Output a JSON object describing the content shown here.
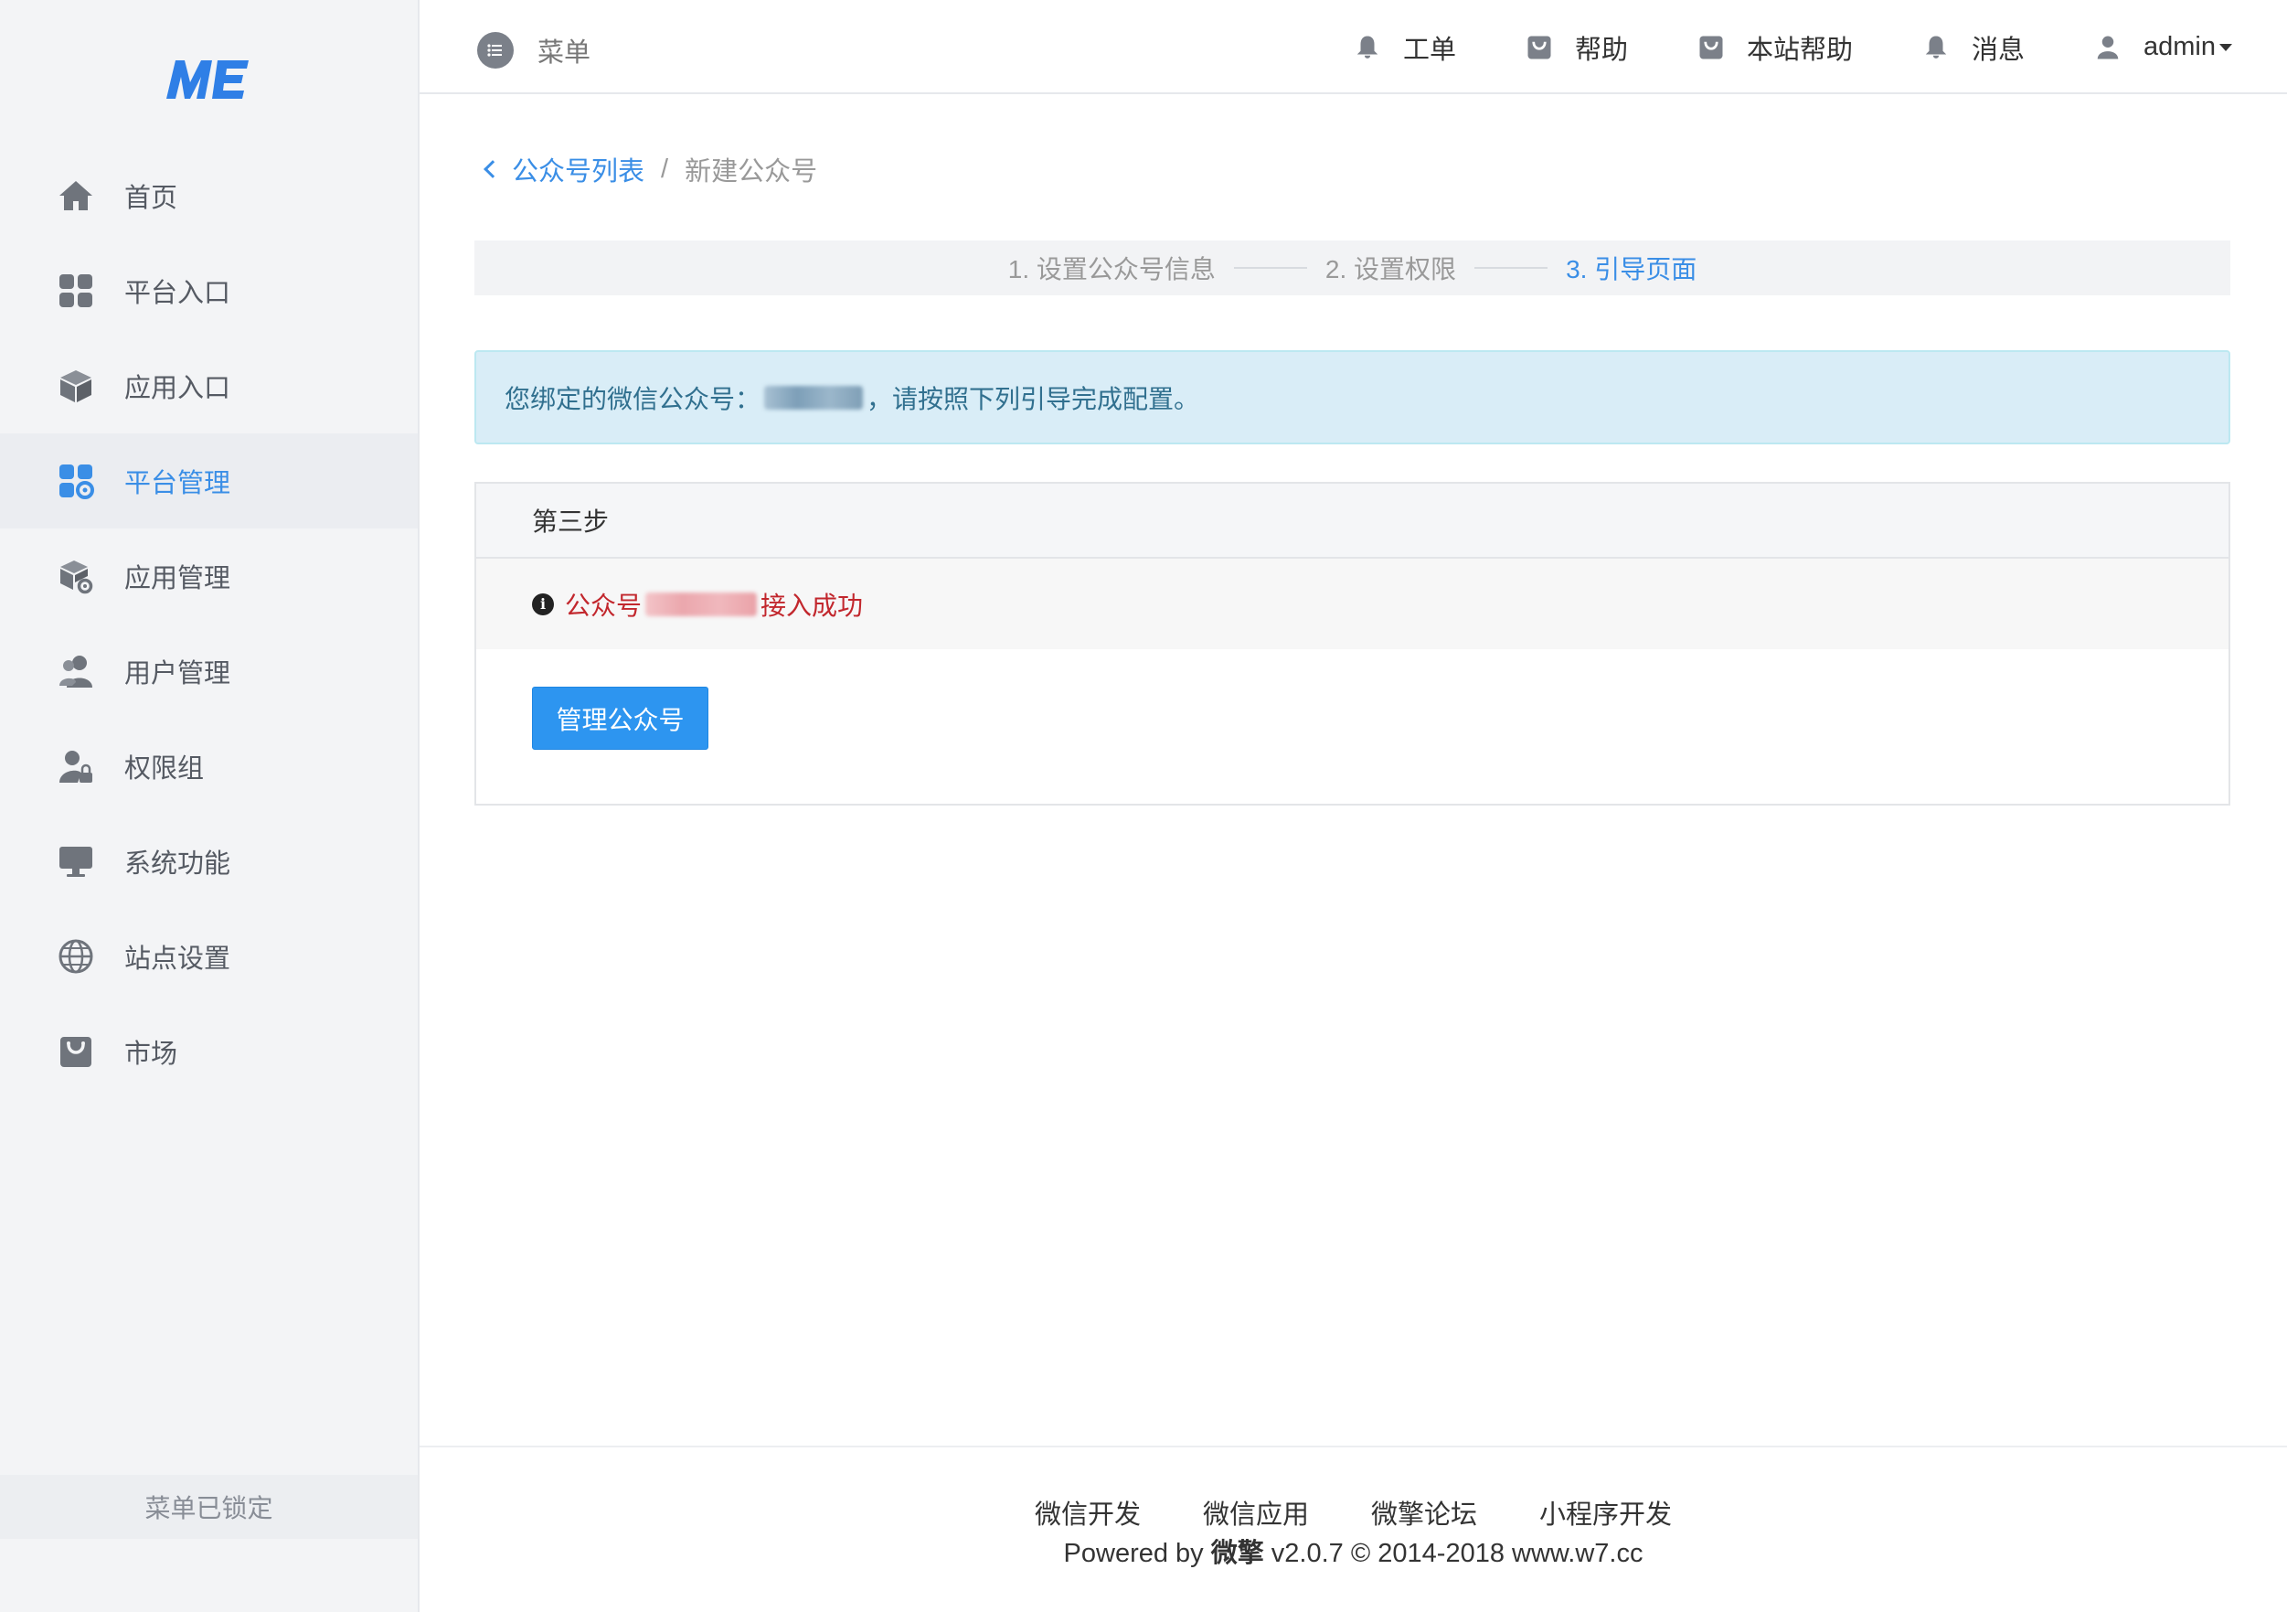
{
  "logo": {
    "text": "ME"
  },
  "sidebar": {
    "items": [
      {
        "label": "首页",
        "icon": "home-icon"
      },
      {
        "label": "平台入口",
        "icon": "grid-icon"
      },
      {
        "label": "应用入口",
        "icon": "cube-icon"
      },
      {
        "label": "平台管理",
        "icon": "grid-gear-icon",
        "active": true
      },
      {
        "label": "应用管理",
        "icon": "cube-gear-icon"
      },
      {
        "label": "用户管理",
        "icon": "users-icon"
      },
      {
        "label": "权限组",
        "icon": "user-lock-icon"
      },
      {
        "label": "系统功能",
        "icon": "monitor-icon"
      },
      {
        "label": "站点设置",
        "icon": "globe-icon"
      },
      {
        "label": "市场",
        "icon": "shop-bag-icon"
      }
    ],
    "lock_text": "菜单已锁定"
  },
  "header": {
    "menu_label": "菜单",
    "items": [
      {
        "label": "工单",
        "icon": "bell-icon"
      },
      {
        "label": "帮助",
        "icon": "bag-icon"
      },
      {
        "label": "本站帮助",
        "icon": "bag-icon"
      },
      {
        "label": "消息",
        "icon": "bell-icon"
      },
      {
        "label": "admin",
        "icon": "user-icon"
      }
    ]
  },
  "breadcrumb": {
    "back_label": "公众号列表",
    "separator": "/",
    "current": "新建公众号"
  },
  "steps": {
    "items": [
      "1. 设置公众号信息",
      "2. 设置权限",
      "3. 引导页面"
    ],
    "active_index": 2
  },
  "alert": {
    "prefix": "您绑定的微信公众号：",
    "suffix": "，请按照下列引导完成配置。"
  },
  "panel": {
    "title": "第三步",
    "msg_prefix": "公众号",
    "msg_suffix": "接入成功",
    "button_label": "管理公众号"
  },
  "footer": {
    "links": [
      "微信开发",
      "微信应用",
      "微擎论坛",
      "小程序开发"
    ],
    "copy_prefix": "Powered by ",
    "copy_brand": "微擎",
    "copy_suffix": " v2.0.7 © 2014-2018 www.w7.cc"
  },
  "colors": {
    "accent": "#3a8ee6",
    "button": "#2d95f0",
    "alert_bg": "#d9edf7",
    "error_text": "#c2272d",
    "sidebar_bg": "#f3f4f6"
  }
}
